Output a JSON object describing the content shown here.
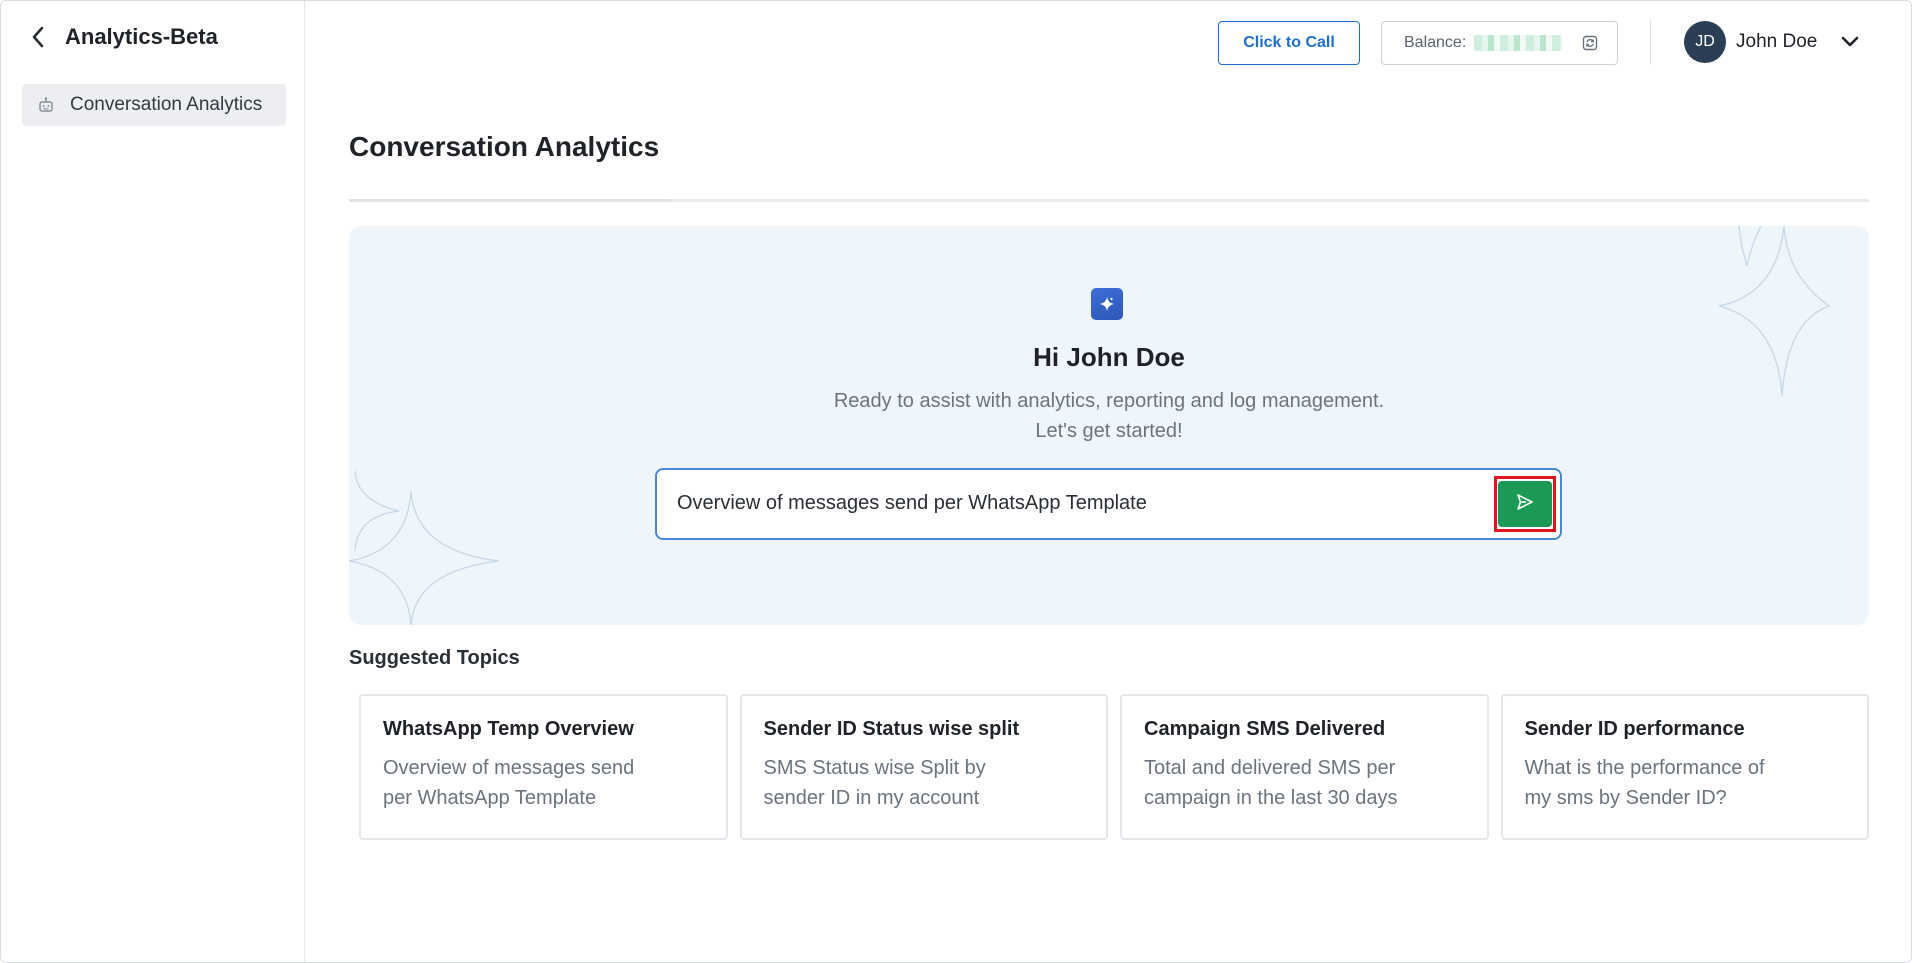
{
  "sidebar": {
    "title": "Analytics-Beta",
    "back_icon": "chevron-left-icon",
    "items": [
      {
        "label": "Conversation Analytics",
        "icon": "robot-icon",
        "active": true
      }
    ]
  },
  "topbar": {
    "click_to_call_label": "Click to Call",
    "balance_label": "Balance:",
    "balance_value_obscured": true,
    "refresh_icon": "refresh-icon",
    "user": {
      "initials": "JD",
      "name": "John Doe",
      "menu_icon": "chevron-down-icon"
    }
  },
  "main": {
    "page_title": "Conversation Analytics",
    "hero": {
      "icon": "sparkle-icon",
      "greeting": "Hi John Doe",
      "subtitle_line1": "Ready to assist with analytics, reporting and log management.",
      "subtitle_line2": "Let's get started!",
      "input_value": "Overview of messages send per WhatsApp Template",
      "send_icon": "send-icon"
    },
    "suggested_title": "Suggested Topics",
    "suggested_topics": [
      {
        "title": "WhatsApp Temp Overview",
        "desc_line1": "Overview of messages send",
        "desc_line2": "per WhatsApp Template"
      },
      {
        "title": "Sender ID Status wise split",
        "desc_line1": "SMS Status wise Split by",
        "desc_line2": "sender ID in my account"
      },
      {
        "title": "Campaign SMS Delivered",
        "desc_line1": "Total and delivered SMS per",
        "desc_line2": "campaign in the last 30 days"
      },
      {
        "title": "Sender ID performance",
        "desc_line1": "What is the performance of",
        "desc_line2": "my sms by Sender ID?"
      }
    ]
  },
  "colors": {
    "primary_blue": "#1f6fd1",
    "send_green": "#1b9a56",
    "hero_bg": "#eef6fc",
    "highlight_red": "#e0141e",
    "avatar_bg": "#2c3e55"
  }
}
